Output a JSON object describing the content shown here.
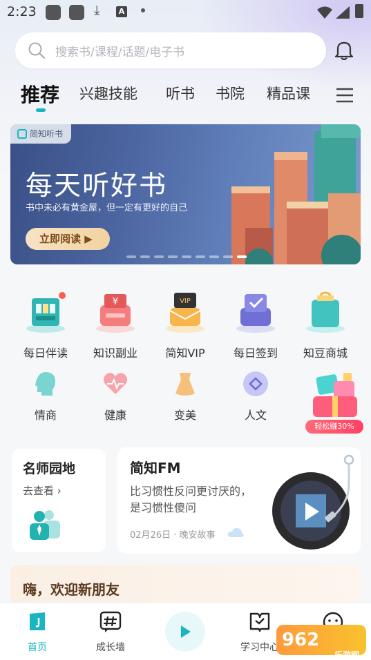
{
  "status_bar": {
    "time": "2:23",
    "download_icon": "download-icon",
    "a_icon": "A"
  },
  "search": {
    "placeholder": "搜索书/课程/话题/电子书"
  },
  "tabs": [
    {
      "label": "推荐",
      "active": true
    },
    {
      "label": "兴趣技能"
    },
    {
      "label": "听书"
    },
    {
      "label": "书院"
    },
    {
      "label": "精品课"
    }
  ],
  "banner": {
    "tag": "简知听书",
    "title": "每天听好书",
    "subtitle": "书中未必有黄金屋，但一定有更好的自己",
    "button": "立即阅读 ▶",
    "slide_count": 9,
    "active_slide": 9
  },
  "grid_row1": [
    {
      "label": "每日伴读",
      "icon": "bookshelf-icon"
    },
    {
      "label": "知识副业",
      "icon": "money-register-icon"
    },
    {
      "label": "简知VIP",
      "icon": "vip-icon"
    },
    {
      "label": "每日签到",
      "icon": "calendar-check-icon"
    },
    {
      "label": "知豆商城",
      "icon": "shopping-bag-icon"
    }
  ],
  "grid_row2": [
    {
      "label": "情商",
      "icon": "head-icon"
    },
    {
      "label": "健康",
      "icon": "heart-pulse-icon"
    },
    {
      "label": "变美",
      "icon": "dress-icon"
    },
    {
      "label": "人文",
      "icon": "diamond-icon"
    }
  ],
  "promo": {
    "badge": "轻松赚30%"
  },
  "teacher_card": {
    "title": "名师园地",
    "link": "去查看 ›"
  },
  "fm_card": {
    "title": "简知FM",
    "description": "比习惯性反问更讨厌的，是习惯性傻问",
    "meta": "02月26日 · 晚安故事"
  },
  "welcome": {
    "text": "嗨，欢迎新朋友"
  },
  "bottom_nav": [
    {
      "label": "首页",
      "active": true
    },
    {
      "label": "成长墙"
    },
    {
      "label": "学习中心"
    }
  ],
  "watermark": {
    "text": "962",
    "sub": "乐游网"
  },
  "colors": {
    "accent": "#19b6c2",
    "promo": "#ff3f64",
    "banner_bg": "#4d67a2"
  }
}
